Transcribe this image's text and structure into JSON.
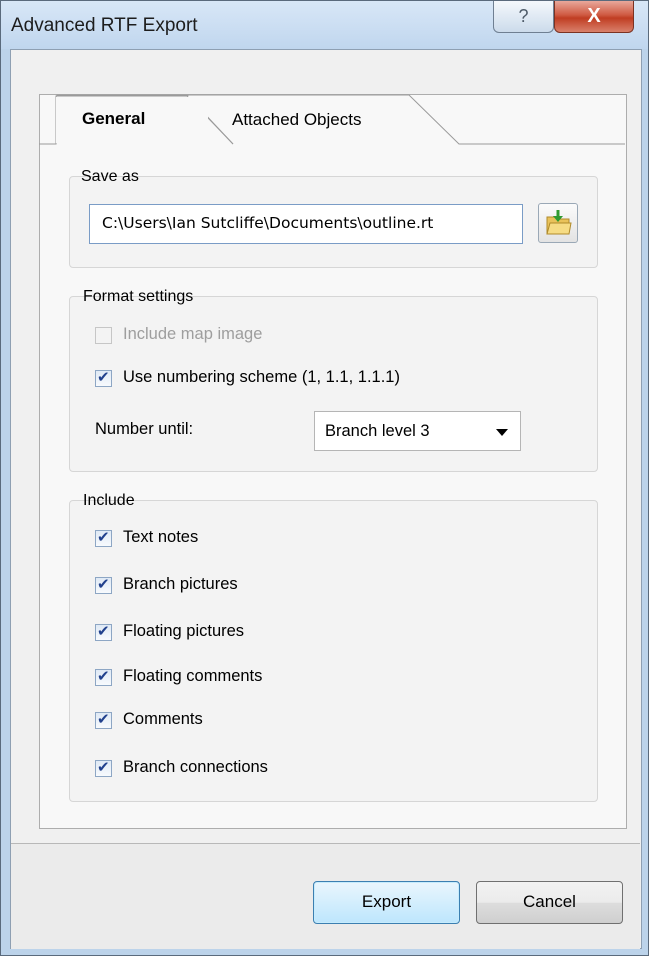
{
  "window": {
    "title": "Advanced RTF Export",
    "help_glyph": "?",
    "close_glyph": "X"
  },
  "tabs": [
    {
      "label": "General",
      "active": true
    },
    {
      "label": "Attached Objects",
      "active": false
    }
  ],
  "save_as": {
    "group_label": "Save as",
    "path_value": "C:\\Users\\Ian Sutcliffe\\Documents\\outline.rt",
    "browse_icon": "folder-open-icon"
  },
  "format_settings": {
    "group_label": "Format settings",
    "include_map_image": {
      "label": "Include map image",
      "checked": false,
      "enabled": false
    },
    "use_numbering": {
      "label": "Use numbering scheme (1, 1.1, 1.1.1)",
      "checked": true,
      "enabled": true
    },
    "number_until_label": "Number until:",
    "number_until_value": "Branch level 3"
  },
  "include": {
    "group_label": "Include",
    "items": [
      {
        "label": "Text notes",
        "checked": true
      },
      {
        "label": "Branch pictures",
        "checked": true
      },
      {
        "label": "Floating pictures",
        "checked": true
      },
      {
        "label": "Floating comments",
        "checked": true
      },
      {
        "label": "Comments",
        "checked": true
      },
      {
        "label": "Branch connections",
        "checked": true
      }
    ]
  },
  "buttons": {
    "export": "Export",
    "cancel": "Cancel"
  },
  "colors": {
    "title_bar": "#c8dcf1",
    "close_button": "#c9452b",
    "checkmark": "#21418d",
    "default_button": "#bde6fd"
  }
}
